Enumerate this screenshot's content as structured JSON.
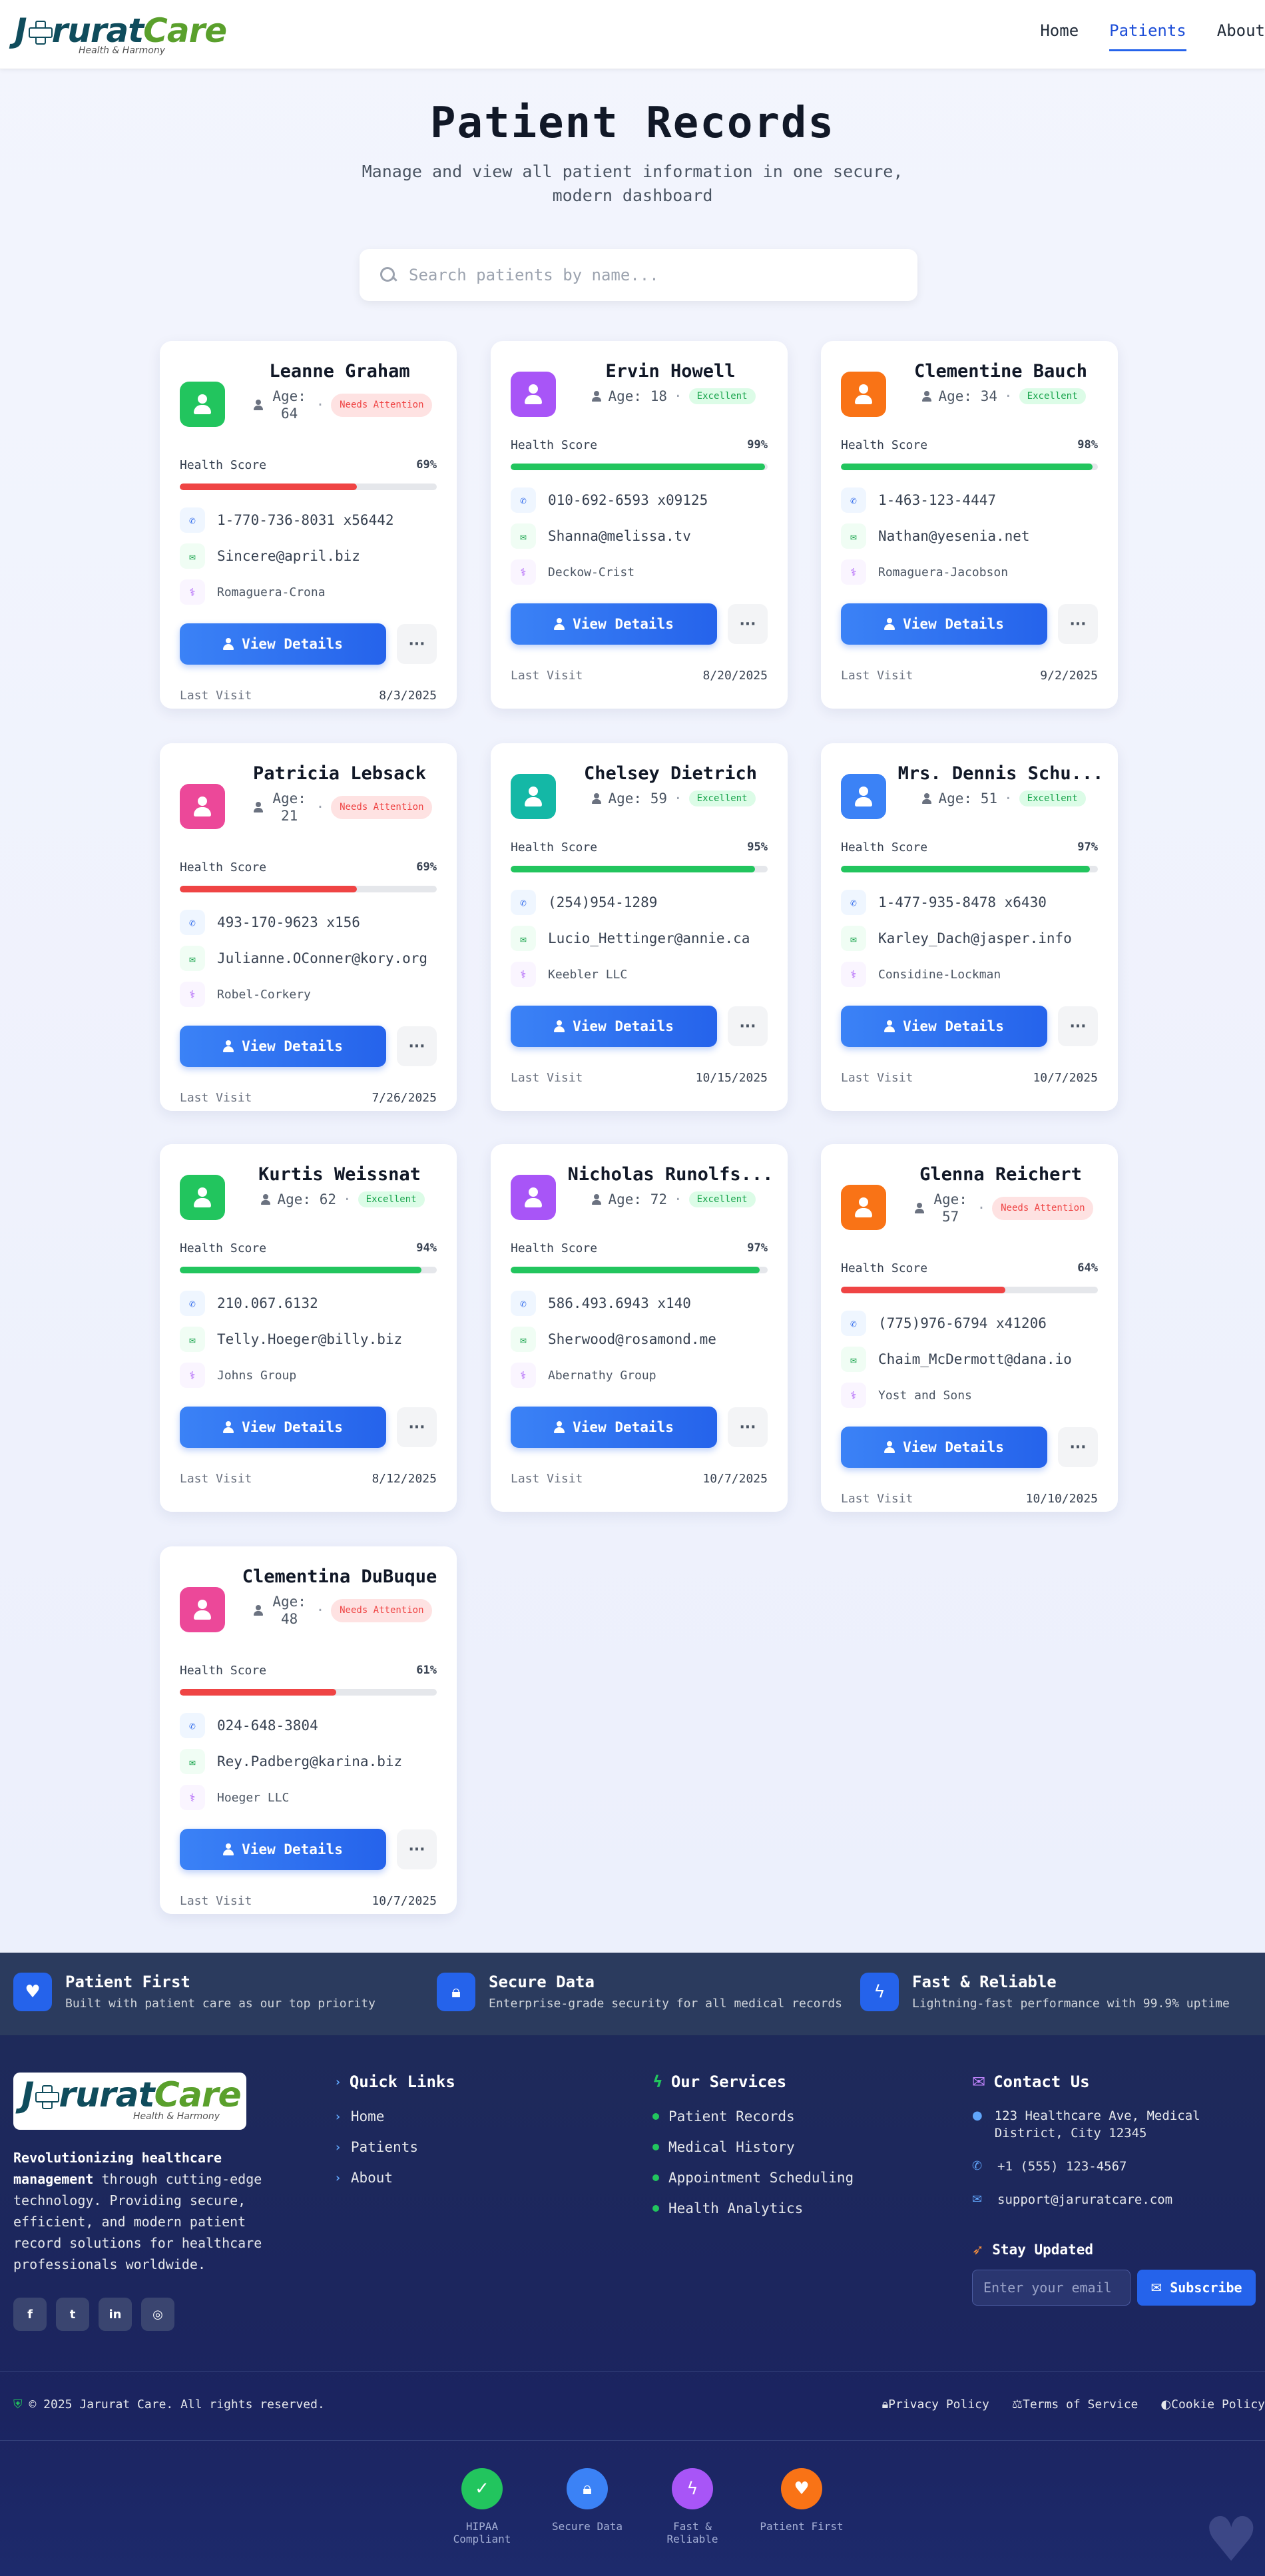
{
  "brand": {
    "logo_j": "J",
    "logo_rest": "rurat",
    "logo_care": "Care",
    "tagline": "Health & Harmony"
  },
  "nav": [
    {
      "label": "Home"
    },
    {
      "label": "Patients"
    },
    {
      "label": "About"
    }
  ],
  "hero": {
    "title": "Patient Records",
    "subtitle": "Manage and view all patient information in one secure, modern dashboard"
  },
  "search": {
    "placeholder": "Search patients by name..."
  },
  "labels": {
    "health_score": "Health Score",
    "view_details": "View Details",
    "more": "···",
    "last_visit": "Last Visit"
  },
  "patients": [
    {
      "name": "Leanne Graham",
      "age": "Age: 64",
      "status": "Needs Attention",
      "score": "69%",
      "score_val": 69,
      "phone": "1-770-736-8031 x56442",
      "email": "Sincere@april.biz",
      "company": "Romaguera-Crona",
      "last_visit": "8/3/2025",
      "color": "#22c55e"
    },
    {
      "name": "Ervin Howell",
      "age": "Age: 18",
      "status": "Excellent",
      "score": "99%",
      "score_val": 99,
      "phone": "010-692-6593 x09125",
      "email": "Shanna@melissa.tv",
      "company": "Deckow-Crist",
      "last_visit": "8/20/2025",
      "color": "#a855f7"
    },
    {
      "name": "Clementine Bauch",
      "age": "Age: 34",
      "status": "Excellent",
      "score": "98%",
      "score_val": 98,
      "phone": "1-463-123-4447",
      "email": "Nathan@yesenia.net",
      "company": "Romaguera-Jacobson",
      "last_visit": "9/2/2025",
      "color": "#f97316"
    },
    {
      "name": "Patricia Lebsack",
      "age": "Age: 21",
      "status": "Needs Attention",
      "score": "69%",
      "score_val": 69,
      "phone": "493-170-9623 x156",
      "email": "Julianne.OConner@kory.org",
      "company": "Robel-Corkery",
      "last_visit": "7/26/2025",
      "color": "#ec4899"
    },
    {
      "name": "Chelsey Dietrich",
      "age": "Age: 59",
      "status": "Excellent",
      "score": "95%",
      "score_val": 95,
      "phone": "(254)954-1289",
      "email": "Lucio_Hettinger@annie.ca",
      "company": "Keebler LLC",
      "last_visit": "10/15/2025",
      "color": "#14b8a6"
    },
    {
      "name": "Mrs. Dennis Schu...",
      "age": "Age: 51",
      "status": "Excellent",
      "score": "97%",
      "score_val": 97,
      "phone": "1-477-935-8478 x6430",
      "email": "Karley_Dach@jasper.info",
      "company": "Considine-Lockman",
      "last_visit": "10/7/2025",
      "color": "#3b82f6"
    },
    {
      "name": "Kurtis Weissnat",
      "age": "Age: 62",
      "status": "Excellent",
      "score": "94%",
      "score_val": 94,
      "phone": "210.067.6132",
      "email": "Telly.Hoeger@billy.biz",
      "company": "Johns Group",
      "last_visit": "8/12/2025",
      "color": "#22c55e"
    },
    {
      "name": "Nicholas Runolfs...",
      "age": "Age: 72",
      "status": "Excellent",
      "score": "97%",
      "score_val": 97,
      "phone": "586.493.6943 x140",
      "email": "Sherwood@rosamond.me",
      "company": "Abernathy Group",
      "last_visit": "10/7/2025",
      "color": "#a855f7"
    },
    {
      "name": "Glenna Reichert",
      "age": "Age: 57",
      "status": "Needs Attention",
      "score": "64%",
      "score_val": 64,
      "phone": "(775)976-6794 x41206",
      "email": "Chaim_McDermott@dana.io",
      "company": "Yost and Sons",
      "last_visit": "10/10/2025",
      "color": "#f97316"
    },
    {
      "name": "Clementina DuBuque",
      "age": "Age: 48",
      "status": "Needs Attention",
      "score": "61%",
      "score_val": 61,
      "phone": "024-648-3804",
      "email": "Rey.Padberg@karina.biz",
      "company": "Hoeger LLC",
      "last_visit": "10/7/2025",
      "color": "#ec4899"
    }
  ],
  "features": [
    {
      "title": "Patient First",
      "desc": "Built with patient care as our top priority",
      "icon": "heart-icon"
    },
    {
      "title": "Secure Data",
      "desc": "Enterprise-grade security for all medical records",
      "icon": "lock-icon"
    },
    {
      "title": "Fast & Reliable",
      "desc": "Lightning-fast performance with 99.9% uptime",
      "icon": "bolt-icon"
    }
  ],
  "footer": {
    "about_bold": "Revolutionizing healthcare management",
    "about_rest": " through cutting-edge technology. Providing secure, efficient, and modern patient record solutions for healthcare professionals worldwide.",
    "socials": [
      "f",
      "t",
      "in",
      "◎"
    ],
    "quick_links_title": "Quick Links",
    "quick_links": [
      "Home",
      "Patients",
      "About"
    ],
    "services_title": "Our Services",
    "services": [
      "Patient Records",
      "Medical History",
      "Appointment Scheduling",
      "Health Analytics"
    ],
    "contact_title": "Contact Us",
    "address": "123 Healthcare Ave, Medical District, City 12345",
    "phone": "+1 (555) 123-4567",
    "email": "support@jaruratcare.com",
    "stay_updated": "Stay Updated",
    "email_placeholder": "Enter your email",
    "subscribe": "Subscribe",
    "copyright": "© 2025 Jarurat Care. All rights reserved.",
    "legal": [
      "Privacy Policy",
      "Terms of Service",
      "Cookie Policy"
    ],
    "trust": [
      {
        "label": "HIPAA Compliant",
        "color": "#22c55e"
      },
      {
        "label": "Secure Data",
        "color": "#3b82f6"
      },
      {
        "label": "Fast & Reliable",
        "color": "#a855f7"
      },
      {
        "label": "Patient First",
        "color": "#f97316"
      }
    ]
  }
}
